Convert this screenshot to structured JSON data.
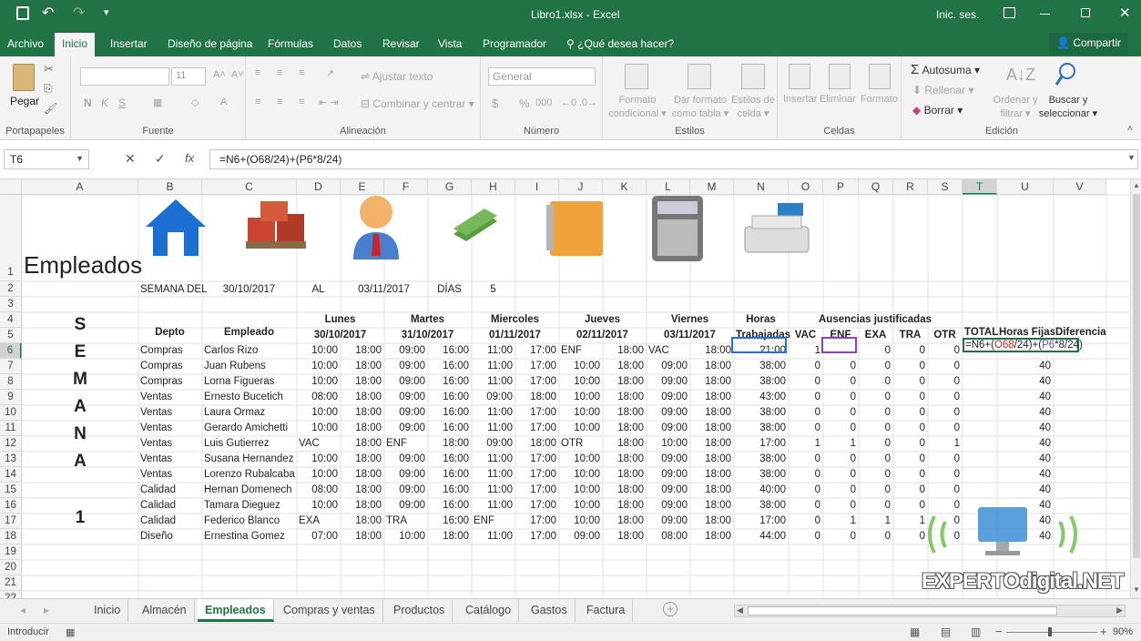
{
  "window": {
    "filename": "Libro1.xlsx",
    "app": "Excel",
    "signin": "Inic. ses."
  },
  "tabs": [
    "Archivo",
    "Inicio",
    "Insertar",
    "Diseño de página",
    "Fórmulas",
    "Datos",
    "Revisar",
    "Vista",
    "Programador"
  ],
  "tell_me": "¿Qué desea hacer?",
  "share": "Compartir",
  "ribbon": {
    "portapapeles": {
      "label": "Portapapeles",
      "paste": "Pegar"
    },
    "fuente": {
      "label": "Fuente",
      "size": "11",
      "bold": "N",
      "italic": "K",
      "underline": "S"
    },
    "alineacion": {
      "label": "Alineación",
      "wrap": "Ajustar texto",
      "merge": "Combinar y centrar"
    },
    "numero": {
      "label": "Número",
      "format": "General",
      "percent": "%",
      "thousands": "000",
      "currency": "$"
    },
    "estilos": {
      "label": "Estilos",
      "cond1": "Formato",
      "cond2": "condicional",
      "table1": "Dar formato",
      "table2": "como tabla",
      "cell1": "Estilos de",
      "cell2": "celda"
    },
    "celdas": {
      "label": "Celdas",
      "insert": "Insertar",
      "delete": "Eliminar",
      "format": "Formato"
    },
    "edicion": {
      "label": "Edición",
      "autosum": "Autosuma",
      "fill": "Rellenar",
      "clear": "Borrar",
      "sort1": "Ordenar y",
      "sort2": "filtrar",
      "find1": "Buscar y",
      "find2": "seleccionar"
    }
  },
  "formula_bar": {
    "name_box": "T6",
    "formula": "=N6+(O68/24)+(P6*8/24)",
    "fx": "fx"
  },
  "columns": [
    "A",
    "B",
    "C",
    "D",
    "E",
    "F",
    "G",
    "H",
    "I",
    "J",
    "K",
    "L",
    "M",
    "N",
    "O",
    "P",
    "Q",
    "R",
    "S",
    "T",
    "U",
    "V"
  ],
  "rows": [
    "1",
    "2",
    "3",
    "4",
    "5",
    "6",
    "7",
    "8",
    "9",
    "10",
    "11",
    "12",
    "13",
    "14",
    "15",
    "16",
    "17",
    "18",
    "19",
    "20",
    "21",
    "22"
  ],
  "sheet": {
    "title": "Empleados",
    "semana_del": "SEMANA DEL",
    "start_date": "30/10/2017",
    "al": "AL",
    "end_date": "03/11/2017",
    "dias": "DÍAS",
    "dias_val": "5",
    "vertical": [
      "S",
      "E",
      "M",
      "A",
      "N",
      "A",
      "1"
    ],
    "headers": {
      "depto": "Depto",
      "empleado": "Empleado",
      "horas": "Horas",
      "trabajadas": "Trabajadas",
      "ausencias": "Ausencias justificadas",
      "vac": "VAC",
      "enf": "ENF",
      "exa": "EXA",
      "tra": "TRA",
      "otr": "OTR",
      "total": "TOTAL",
      "horas_fijas": "Horas Fijas",
      "diferencia": "Diferencia"
    },
    "days": [
      {
        "name": "Lunes",
        "date": "30/10/2017"
      },
      {
        "name": "Martes",
        "date": "31/10/2017"
      },
      {
        "name": "Miercoles",
        "date": "01/11/2017"
      },
      {
        "name": "Jueves",
        "date": "02/11/2017"
      },
      {
        "name": "Viernes",
        "date": "03/11/2017"
      }
    ],
    "t6_formula": {
      "a": "=N6+(",
      "b": "O68",
      "c": "/24)+(",
      "d": "P6",
      "e": "*8/24)"
    },
    "employees": [
      [
        "Compras",
        "Carlos Rizo",
        "10:00",
        "18:00",
        "09:00",
        "16:00",
        "11:00",
        "17:00",
        "ENF",
        "18:00",
        "VAC",
        "18:00",
        "21:00",
        "1",
        "",
        "0",
        "0",
        "0",
        "",
        ""
      ],
      [
        "Compras",
        "Juan Rubens",
        "10:00",
        "18:00",
        "09:00",
        "16:00",
        "11:00",
        "17:00",
        "10:00",
        "18:00",
        "09:00",
        "18:00",
        "38:00",
        "0",
        "0",
        "0",
        "0",
        "0",
        "",
        "40"
      ],
      [
        "Compras",
        "Lorna Figueras",
        "10:00",
        "18:00",
        "09:00",
        "16:00",
        "11:00",
        "17:00",
        "10:00",
        "18:00",
        "09:00",
        "18:00",
        "38:00",
        "0",
        "0",
        "0",
        "0",
        "0",
        "",
        "40"
      ],
      [
        "Ventas",
        "Ernesto Bucetich",
        "08:00",
        "18:00",
        "09:00",
        "16:00",
        "09:00",
        "18:00",
        "10:00",
        "18:00",
        "09:00",
        "18:00",
        "43:00",
        "0",
        "0",
        "0",
        "0",
        "0",
        "",
        "40"
      ],
      [
        "Ventas",
        "Laura Ormaz",
        "10:00",
        "18:00",
        "09:00",
        "16:00",
        "11:00",
        "17:00",
        "10:00",
        "18:00",
        "09:00",
        "18:00",
        "38:00",
        "0",
        "0",
        "0",
        "0",
        "0",
        "",
        "40"
      ],
      [
        "Ventas",
        "Gerardo Amichetti",
        "10:00",
        "18:00",
        "09:00",
        "16:00",
        "11:00",
        "17:00",
        "10:00",
        "18:00",
        "09:00",
        "18:00",
        "38:00",
        "0",
        "0",
        "0",
        "0",
        "0",
        "",
        "40"
      ],
      [
        "Ventas",
        "Luis Gutierrez",
        "VAC",
        "18:00",
        "ENF",
        "18:00",
        "09:00",
        "18:00",
        "OTR",
        "18:00",
        "10:00",
        "18:00",
        "17:00",
        "1",
        "1",
        "0",
        "0",
        "1",
        "",
        "40"
      ],
      [
        "Ventas",
        "Susana Hernandez",
        "10:00",
        "18:00",
        "09:00",
        "16:00",
        "11:00",
        "17:00",
        "10:00",
        "18:00",
        "09:00",
        "18:00",
        "38:00",
        "0",
        "0",
        "0",
        "0",
        "0",
        "",
        "40"
      ],
      [
        "Ventas",
        "Lorenzo Rubalcaba",
        "10:00",
        "18:00",
        "09:00",
        "16:00",
        "11:00",
        "17:00",
        "10:00",
        "18:00",
        "09:00",
        "18:00",
        "38:00",
        "0",
        "0",
        "0",
        "0",
        "0",
        "",
        "40"
      ],
      [
        "Calidad",
        "Hernan Domenech",
        "08:00",
        "18:00",
        "09:00",
        "16:00",
        "11:00",
        "17:00",
        "10:00",
        "18:00",
        "09:00",
        "18:00",
        "40:00",
        "0",
        "0",
        "0",
        "0",
        "0",
        "",
        "40"
      ],
      [
        "Calidad",
        "Tamara Dieguez",
        "10:00",
        "18:00",
        "09:00",
        "16:00",
        "11:00",
        "17:00",
        "10:00",
        "18:00",
        "09:00",
        "18:00",
        "38:00",
        "0",
        "0",
        "0",
        "0",
        "0",
        "",
        "40"
      ],
      [
        "Calidad",
        "Federico Blanco",
        "EXA",
        "18:00",
        "TRA",
        "16:00",
        "ENF",
        "17:00",
        "10:00",
        "18:00",
        "09:00",
        "18:00",
        "17:00",
        "0",
        "1",
        "1",
        "1",
        "0",
        "",
        "40"
      ],
      [
        "Diseño",
        "Ernestina Gomez",
        "07:00",
        "18:00",
        "10:00",
        "18:00",
        "11:00",
        "17:00",
        "09:00",
        "18:00",
        "08:00",
        "18:00",
        "44:00",
        "0",
        "0",
        "0",
        "0",
        "0",
        "",
        "40"
      ]
    ]
  },
  "sheet_tabs": [
    "Inicio",
    "Almacén",
    "Empleados",
    "Compras y ventas",
    "Productos",
    "Catálogo",
    "Gastos",
    "Factura"
  ],
  "active_sheet": "Empleados",
  "status": {
    "mode": "Introducir",
    "zoom": "90%"
  },
  "watermark": "EXPERTOdigital.NET"
}
